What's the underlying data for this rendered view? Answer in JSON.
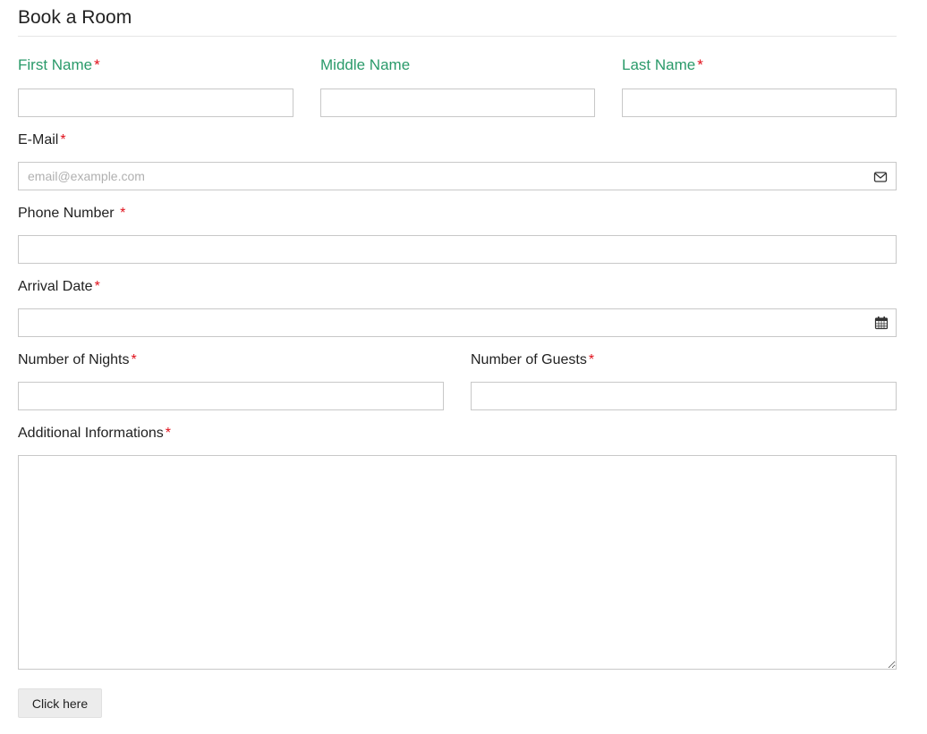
{
  "form": {
    "title": "Book a Room",
    "required_mark": "*",
    "first_name": {
      "label": "First Name",
      "value": ""
    },
    "middle_name": {
      "label": "Middle Name",
      "value": ""
    },
    "last_name": {
      "label": "Last Name",
      "value": ""
    },
    "email": {
      "label": "E-Mail",
      "placeholder": "email@example.com",
      "icon": "envelope-icon"
    },
    "phone": {
      "label": "Phone Number"
    },
    "arrival": {
      "label": "Arrival Date",
      "icon": "calendar-icon"
    },
    "nights": {
      "label": "Number of Nights"
    },
    "guests": {
      "label": "Number of Guests"
    },
    "additional": {
      "label": "Additional Informations"
    },
    "submit_label": "Click here"
  },
  "colors": {
    "name_label": "#2a9a6a",
    "required": "#e0101b",
    "border": "#c8c8c8",
    "button_bg": "#ececec"
  }
}
